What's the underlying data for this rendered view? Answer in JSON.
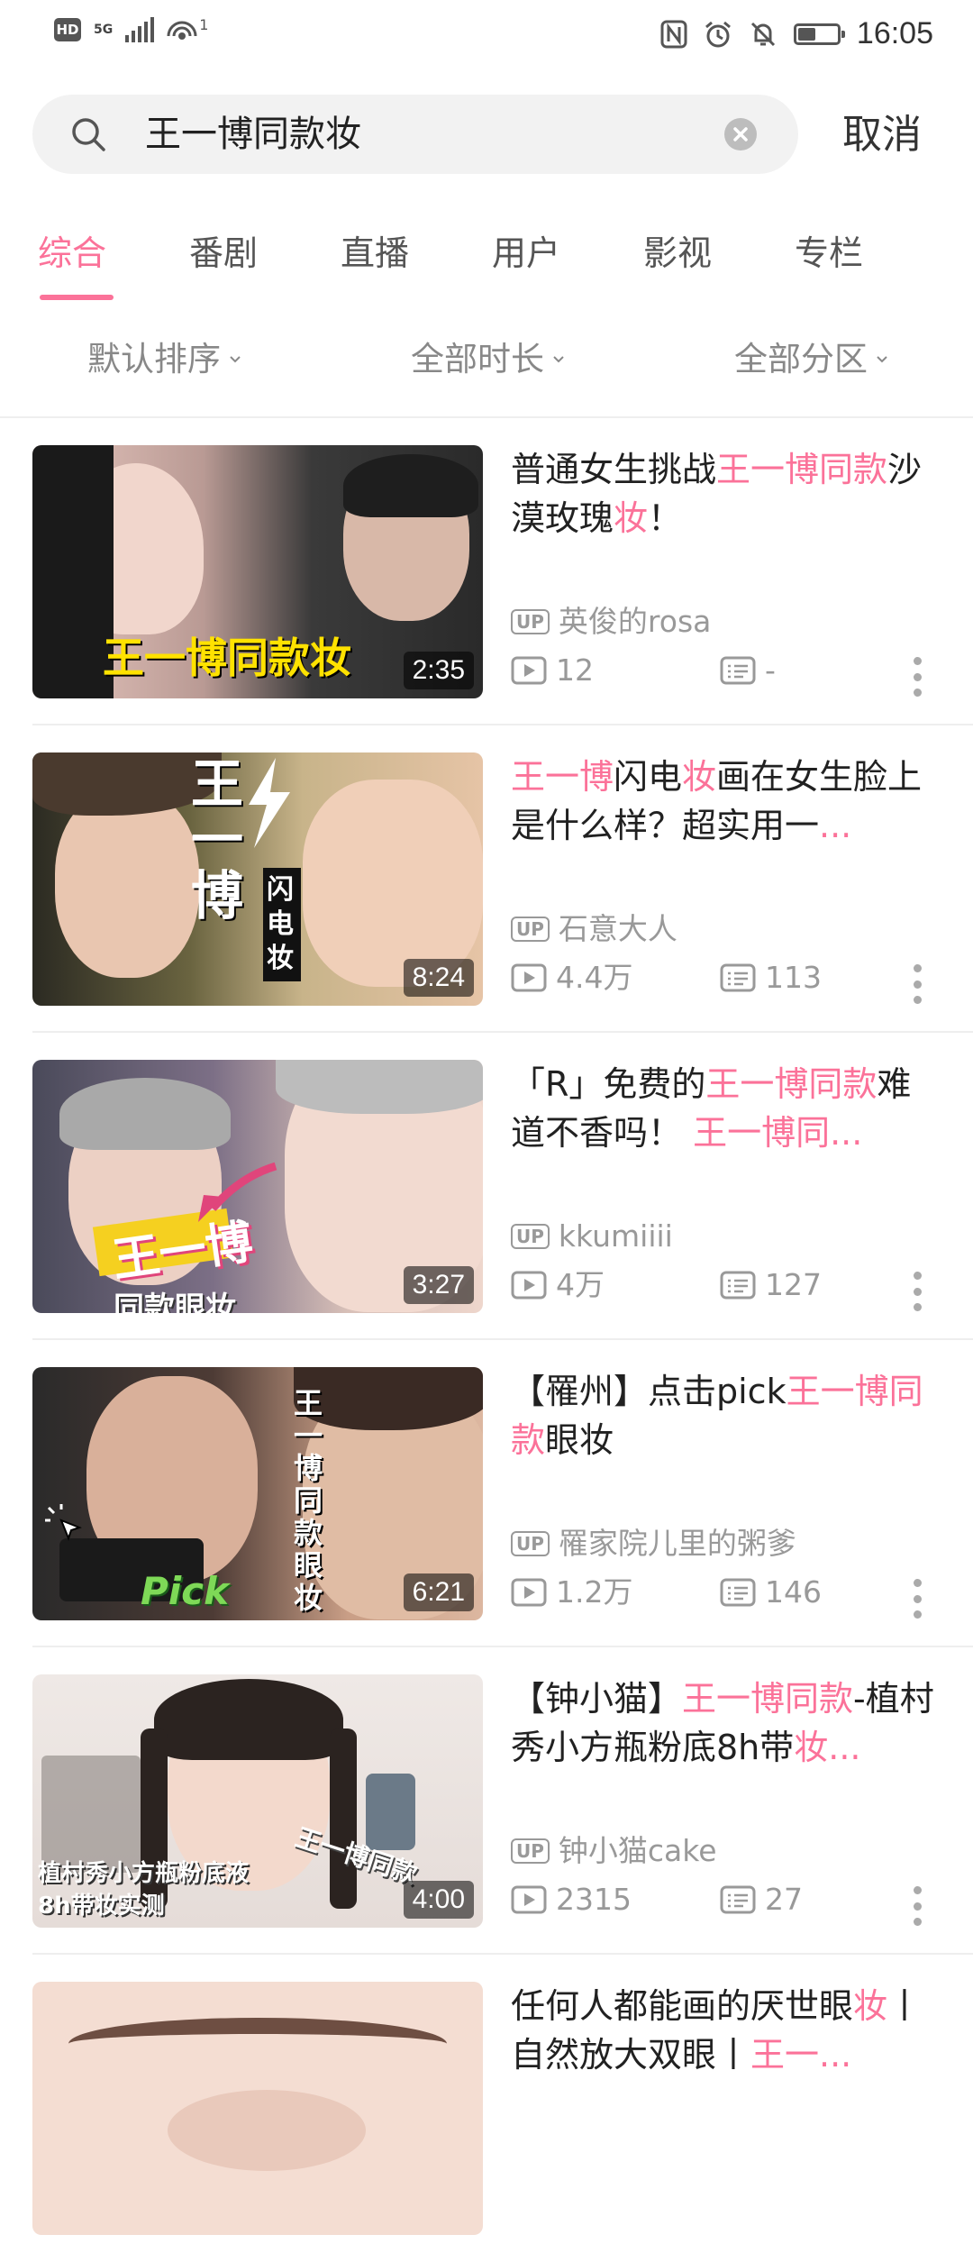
{
  "status_bar": {
    "hd": "HD",
    "net": "5G",
    "wifi_sup": "1",
    "time": "16:05",
    "battery_level": 0.45
  },
  "search": {
    "query": "王一博同款妆",
    "cancel_label": "取消"
  },
  "tabs": [
    {
      "label": "综合",
      "active": true
    },
    {
      "label": "番剧",
      "active": false
    },
    {
      "label": "直播",
      "active": false
    },
    {
      "label": "用户",
      "active": false
    },
    {
      "label": "影视",
      "active": false
    },
    {
      "label": "专栏",
      "active": false
    }
  ],
  "filters": [
    {
      "label": "默认排序"
    },
    {
      "label": "全部时长"
    },
    {
      "label": "全部分区"
    }
  ],
  "accent_color": "#fb7299",
  "videos": [
    {
      "title_parts": [
        {
          "text": "普通女生挑战",
          "hl": false
        },
        {
          "text": "王一博同款",
          "hl": true
        },
        {
          "text": "沙漠玫瑰",
          "hl": false
        },
        {
          "text": "妆",
          "hl": true
        },
        {
          "text": "！",
          "hl": false
        }
      ],
      "up_badge": "UP",
      "uploader": "英俊的rosa",
      "views": "12",
      "danmaku": "-",
      "duration": "2:35",
      "thumb_text": "王一博同款妆"
    },
    {
      "title_parts": [
        {
          "text": "王一博",
          "hl": true
        },
        {
          "text": "闪电",
          "hl": false
        },
        {
          "text": "妆",
          "hl": true
        },
        {
          "text": "画在女生脸上是什么样？超实用一",
          "hl": false
        },
        {
          "text": "...",
          "hl": true
        }
      ],
      "up_badge": "UP",
      "uploader": "石意大人",
      "views": "4.4万",
      "danmaku": "113",
      "duration": "8:24",
      "thumb_text": "王一博",
      "thumb_text2": "闪电妆"
    },
    {
      "title_parts": [
        {
          "text": "「R」免费的",
          "hl": false
        },
        {
          "text": "王一博同款",
          "hl": true
        },
        {
          "text": "难道不香吗！ ",
          "hl": false
        },
        {
          "text": "王一博同...",
          "hl": true
        }
      ],
      "up_badge": "UP",
      "uploader": "kkumiiii",
      "views": "4万",
      "danmaku": "127",
      "duration": "3:27",
      "thumb_text": "王一博",
      "thumb_text2": "同款眼妆"
    },
    {
      "title_parts": [
        {
          "text": "【罹州】点击pick",
          "hl": false
        },
        {
          "text": "王一博同款",
          "hl": true
        },
        {
          "text": "眼妆",
          "hl": false
        }
      ],
      "up_badge": "UP",
      "uploader": "罹家院儿里的粥爹",
      "views": "1.2万",
      "danmaku": "146",
      "duration": "6:21",
      "thumb_text": "王一博同款眼妆",
      "thumb_text2": "Pick"
    },
    {
      "title_parts": [
        {
          "text": "【钟小猫】",
          "hl": false
        },
        {
          "text": "王一博同款",
          "hl": true
        },
        {
          "text": "-植村秀小方瓶粉底8h带",
          "hl": false
        },
        {
          "text": "妆...",
          "hl": true
        }
      ],
      "up_badge": "UP",
      "uploader": "钟小猫cake",
      "views": "2315",
      "danmaku": "27",
      "duration": "4:00",
      "thumb_text": "植村秀小方瓶粉底液",
      "thumb_text2": "8h带妆实测",
      "thumb_text3": "王一博同款"
    },
    {
      "title_parts": [
        {
          "text": "任何人都能画的厌世眼",
          "hl": false
        },
        {
          "text": "妆",
          "hl": true
        },
        {
          "text": "丨自然放大双眼丨",
          "hl": false
        },
        {
          "text": "王一...",
          "hl": true
        }
      ],
      "up_badge": "",
      "uploader": "",
      "views": "",
      "danmaku": "",
      "duration": ""
    }
  ]
}
